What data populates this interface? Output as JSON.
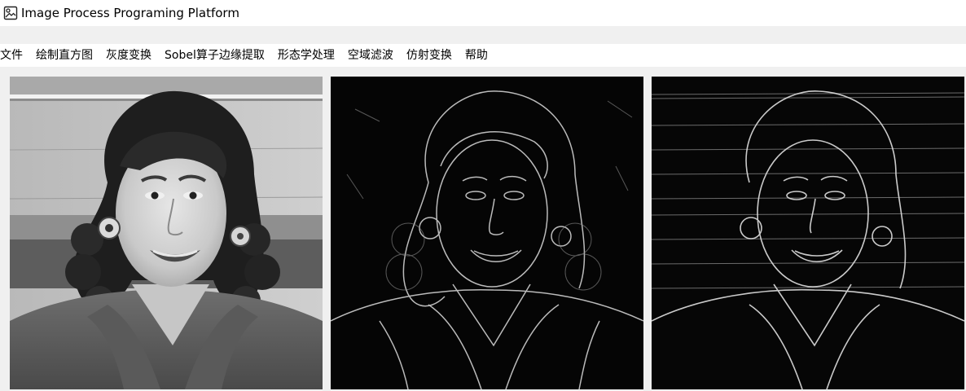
{
  "window": {
    "title": "Image Process Programing Platform",
    "icon": "app-image-icon"
  },
  "menu": {
    "items": [
      {
        "label": "文件"
      },
      {
        "label": "绘制直方图"
      },
      {
        "label": "灰度变换"
      },
      {
        "label": "Sobel算子边缘提取"
      },
      {
        "label": "形态学处理"
      },
      {
        "label": "空域滤波"
      },
      {
        "label": "仿射变换"
      },
      {
        "label": "帮助"
      }
    ]
  },
  "images": {
    "original": {
      "kind": "grayscale-portrait"
    },
    "edge_1": {
      "kind": "edge-map"
    },
    "edge_2": {
      "kind": "edge-map"
    }
  },
  "colors": {
    "window_bg": "#f0f0f0",
    "titlebar_bg": "#ffffff",
    "menubar_bg": "#ffffff",
    "edge_bg": "#050505",
    "edge_line": "#d8d8d8"
  }
}
